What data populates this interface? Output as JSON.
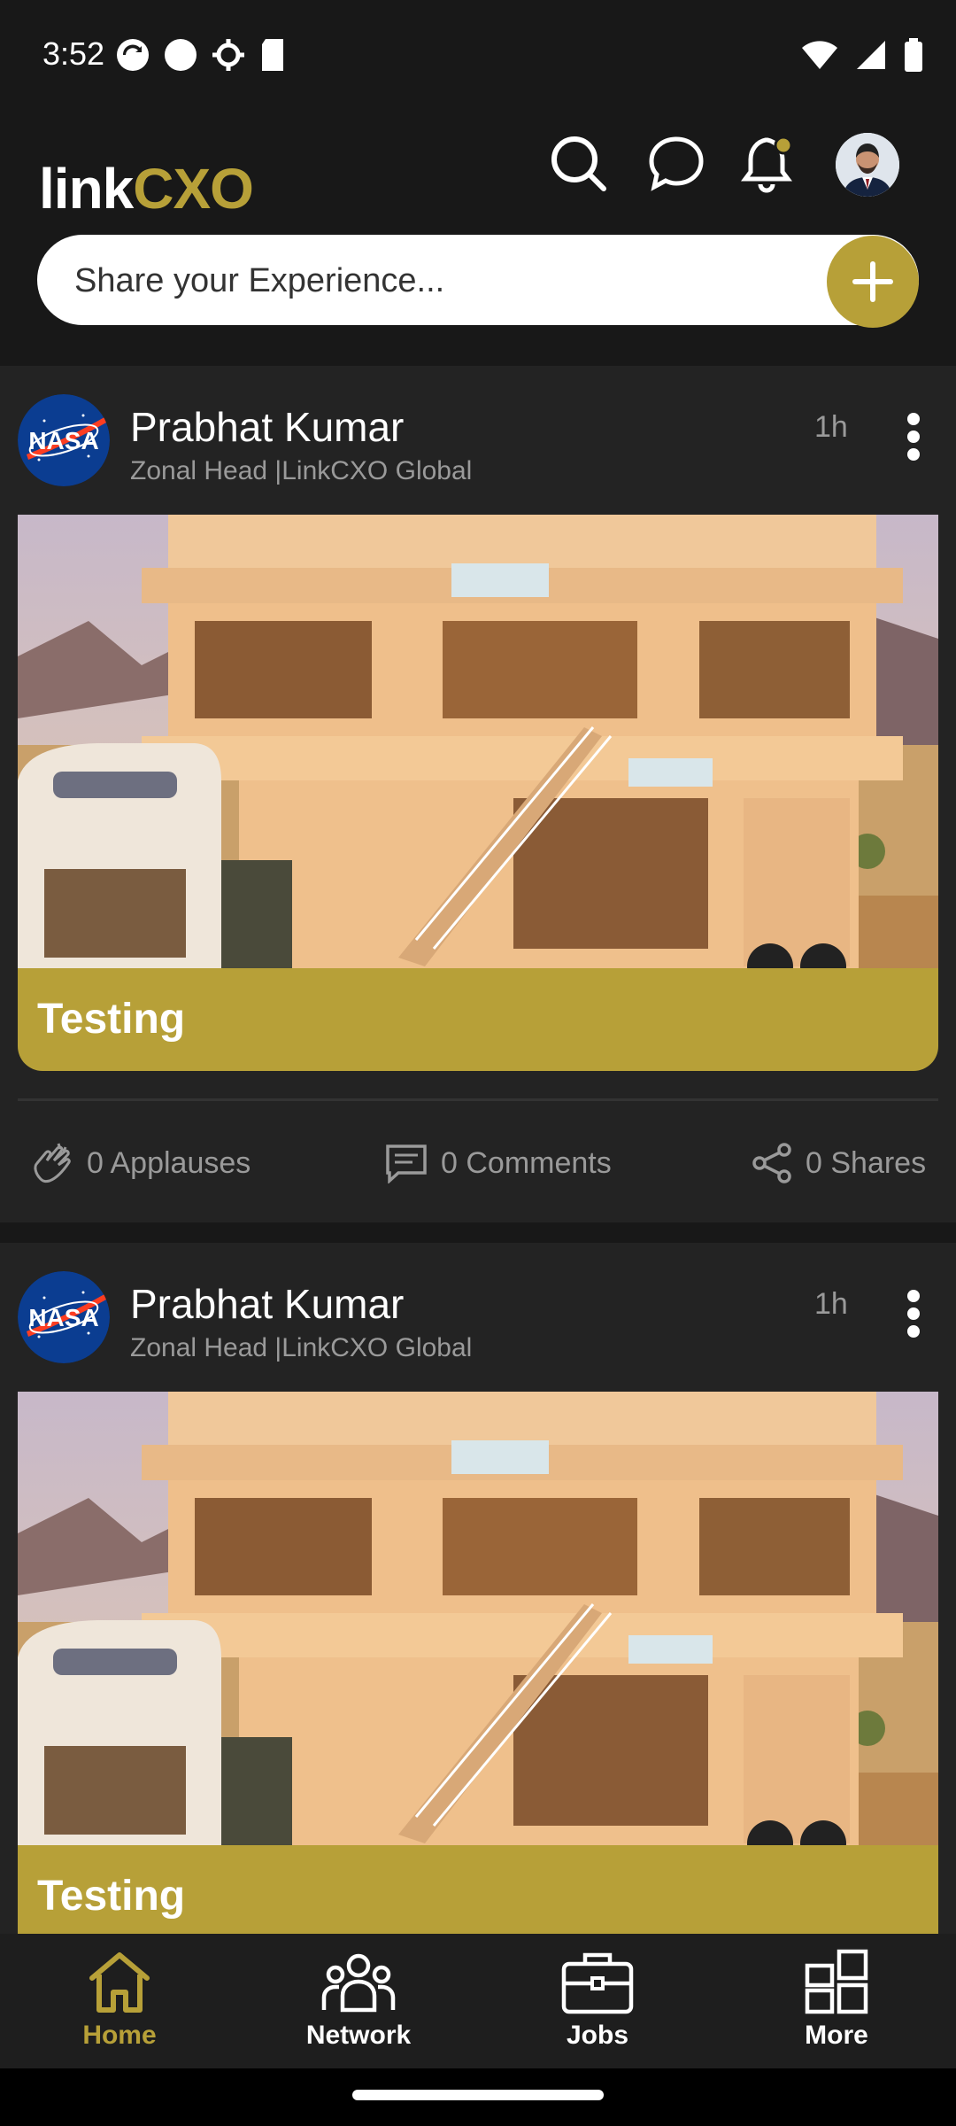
{
  "status_bar": {
    "time": "3:52"
  },
  "app": {
    "logo_prefix": "link",
    "logo_suffix": "CXO",
    "share_placeholder": "Share your Experience..."
  },
  "colors": {
    "accent": "#b7a038",
    "background": "#181818",
    "card": "#232323"
  },
  "icons": [
    "search-icon",
    "chat-icon",
    "bell-icon",
    "plus-icon",
    "more-vertical-icon",
    "applause-icon",
    "comment-icon",
    "share-icon",
    "home-icon",
    "network-icon",
    "jobs-icon",
    "more-grid-icon"
  ],
  "posts": [
    {
      "author": "Prabhat Kumar",
      "subtitle": "Zonal Head |LinkCXO Global",
      "time": "1h",
      "caption": "Testing",
      "applauses": "0 Applauses",
      "comments": "0 Comments",
      "shares": "0 Shares"
    },
    {
      "author": "Prabhat Kumar",
      "subtitle": "Zonal Head |LinkCXO Global",
      "time": "1h",
      "caption": "Testing"
    }
  ],
  "bottom_nav": [
    {
      "label": "Home",
      "active": true
    },
    {
      "label": "Network",
      "active": false
    },
    {
      "label": "Jobs",
      "active": false
    },
    {
      "label": "More",
      "active": false
    }
  ]
}
